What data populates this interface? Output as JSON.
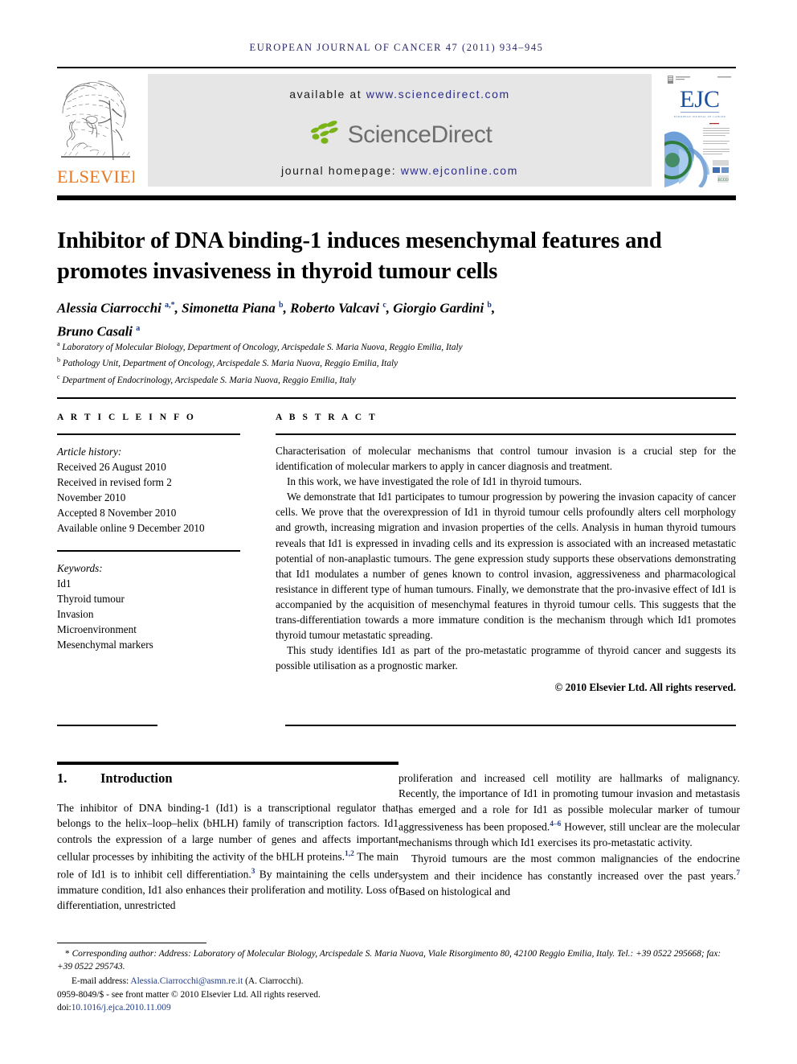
{
  "masthead": {
    "journal_line": "EUROPEAN JOURNAL OF CANCER 47 (2011) 934–945"
  },
  "banner": {
    "publisher_name": "ELSEVIER",
    "available_prefix": "available at ",
    "available_url": "www.sciencedirect.com",
    "sciencedirect_logo_text": "ScienceDirect",
    "homepage_prefix": "journal homepage: ",
    "homepage_url": "www.ejconline.com",
    "cover_title": "EJC",
    "cover_subtitle": "EUROPEAN JOURNAL OF CANCER"
  },
  "article": {
    "title": "Inhibitor of DNA binding-1 induces mesenchymal features and promotes invasiveness in thyroid tumour cells",
    "authors_line_1": "Alessia Ciarrocchi <sup>a,*</sup>, Simonetta Piana <sup>b</sup>, Roberto Valcavi <sup>c</sup>, Giorgio Gardini <sup>b</sup>,",
    "authors_line_2": "Bruno Casali <sup>a</sup>",
    "affiliations": [
      "<sup>a</sup> Laboratory of Molecular Biology, Department of Oncology, Arcispedale S. Maria Nuova, Reggio Emilia, Italy",
      "<sup>b</sup> Pathology Unit, Department of Oncology, Arcispedale S. Maria Nuova, Reggio Emilia, Italy",
      "<sup>c</sup> Department of Endocrinology, Arcispedale S. Maria Nuova, Reggio Emilia, Italy"
    ]
  },
  "article_info": {
    "heading": "A R T I C L E  I N F O",
    "history_label": "Article history:",
    "history": [
      "Received 26 August 2010",
      "Received in revised form 2",
      "November 2010",
      "Accepted 8 November 2010",
      "Available online 9 December 2010"
    ],
    "keywords_label": "Keywords:",
    "keywords": [
      "Id1",
      "Thyroid tumour",
      "Invasion",
      "Microenvironment",
      "Mesenchymal markers"
    ]
  },
  "abstract": {
    "heading": "A B S T R A C T",
    "paragraphs": [
      "Characterisation of molecular mechanisms that control tumour invasion is a crucial step for the identification of molecular markers to apply in cancer diagnosis and treatment.",
      "In this work, we have investigated the role of Id1 in thyroid tumours.",
      "We demonstrate that Id1 participates to tumour progression by powering the invasion capacity of cancer cells. We prove that the overexpression of Id1 in thyroid tumour cells profoundly alters cell morphology and growth, increasing migration and invasion properties of the cells. Analysis in human thyroid tumours reveals that Id1 is expressed in invading cells and its expression is associated with an increased metastatic potential of non-anaplastic tumours. The gene expression study supports these observations demonstrating that Id1 modulates a number of genes known to control invasion, aggressiveness and pharmacological resistance in different type of human tumours. Finally, we demonstrate that the pro-invasive effect of Id1 is accompanied by the acquisition of mesenchymal features in thyroid tumour cells. This suggests that the trans-differentiation towards a more immature condition is the mechanism through which Id1 promotes thyroid tumour metastatic spreading.",
      "This study identifies Id1 as part of the pro-metastatic programme of thyroid cancer and suggests its possible utilisation as a prognostic marker."
    ],
    "copyright": "© 2010 Elsevier Ltd. All rights reserved."
  },
  "body": {
    "section_number": "1.",
    "section_title": "Introduction",
    "left_paragraphs": [
      "The inhibitor of DNA binding-1 (Id1) is a transcriptional regulator that belongs to the helix–loop–helix (bHLH) family of transcription factors. Id1 controls the expression of a large number of genes and affects important cellular processes by inhibiting the activity of the bHLH proteins.<sup>1,2</sup> The main role of Id1 is to inhibit cell differentiation.<sup>3</sup> By maintaining the cells under immature condition, Id1 also enhances their proliferation and motility. Loss of differentiation, unrestricted"
    ],
    "right_paragraphs": [
      "proliferation and increased cell motility are hallmarks of malignancy. Recently, the importance of Id1 in promoting tumour invasion and metastasis has emerged and a role for Id1 as possible molecular marker of tumour aggressiveness has been proposed.<sup>4–6</sup> However, still unclear are the molecular mechanisms through which Id1 exercises its pro-metastatic activity.",
      "Thyroid tumours are the most common malignancies of the endocrine system and their incidence has constantly increased over the past years.<sup>7</sup> Based on histological and"
    ]
  },
  "footnote": {
    "corresponding_star": "*",
    "corresponding_text": "Corresponding author: Address: Laboratory of Molecular Biology, Arcispedale S. Maria Nuova, Viale Risorgimento 80, 42100 Reggio Emilia, Italy. Tel.: +39 0522 295668; fax: +39 0522 295743.",
    "email_label": "E-mail address: ",
    "email_address": "Alessia.Ciarrocchi@asmn.re.it",
    "email_attrib": " (A. Ciarrocchi).",
    "issn_line": "0959-8049/$ - see front matter © 2010 Elsevier Ltd. All rights reserved.",
    "doi_label": "doi:",
    "doi_value": "10.1016/j.ejca.2010.11.009"
  },
  "colors": {
    "masthead_blue": "#27276a",
    "link_blue": "#2b2b8f",
    "sup_blue": "#1f3c88",
    "elsevier_orange": "#e87722",
    "sd_green": "#7ab317",
    "sd_gray": "#6e6e6e",
    "banner_gray": "#e6e6e6"
  }
}
